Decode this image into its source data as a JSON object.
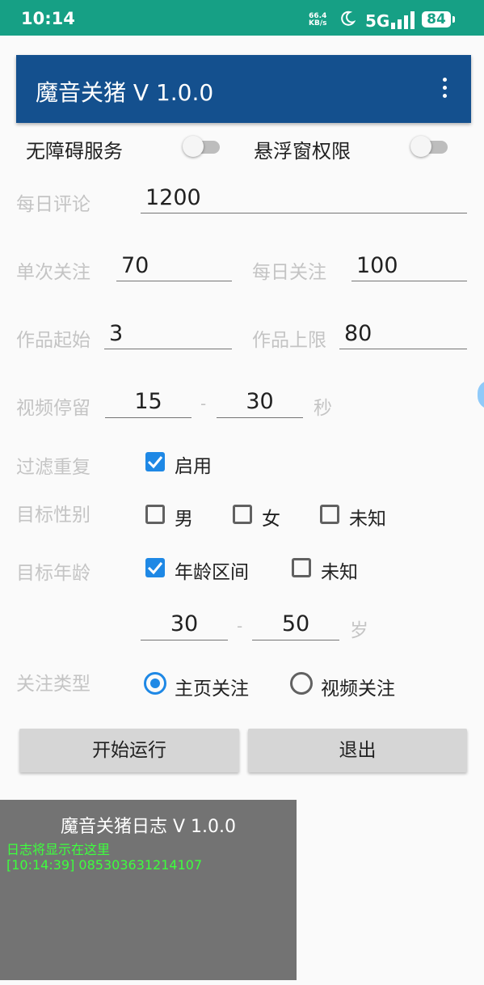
{
  "status_bar": {
    "time": "10:14",
    "net_speed": "66.4",
    "net_unit": "KB/s",
    "network": "5G",
    "battery": "84",
    "icons": [
      "moon-icon",
      "signal-icon",
      "battery-icon"
    ]
  },
  "app_bar": {
    "title": "魔音关猪 V 1.0.0",
    "menu_icon": "more-vert-icon"
  },
  "permissions": {
    "accessibility_label": "无障碍服务",
    "overlay_label": "悬浮窗权限"
  },
  "form": {
    "daily_comment": {
      "label": "每日评论",
      "value": "1200"
    },
    "single_follow": {
      "label": "单次关注",
      "value": "70"
    },
    "daily_follow": {
      "label": "每日关注",
      "value": "100"
    },
    "works_start": {
      "label": "作品起始",
      "value": "3"
    },
    "works_limit": {
      "label": "作品上限",
      "value": "80"
    },
    "video_stay": {
      "label": "视频停留",
      "min": "15",
      "sep": "-",
      "max": "30",
      "unit": "秒"
    },
    "filter_dup": {
      "label": "过滤重复",
      "option": "启用",
      "checked": true
    },
    "gender": {
      "label": "目标性别",
      "options": [
        {
          "label": "男",
          "checked": false
        },
        {
          "label": "女",
          "checked": false
        },
        {
          "label": "未知",
          "checked": false
        }
      ]
    },
    "age": {
      "label": "目标年龄",
      "options": [
        {
          "label": "年龄区间",
          "checked": true
        },
        {
          "label": "未知",
          "checked": false
        }
      ],
      "min": "30",
      "sep": "-",
      "max": "50",
      "unit": "岁"
    },
    "follow_type": {
      "label": "关注类型",
      "options": [
        {
          "label": "主页关注",
          "selected": true
        },
        {
          "label": "视频关注",
          "selected": false
        }
      ]
    }
  },
  "buttons": {
    "start": "开始运行",
    "exit": "退出"
  },
  "log": {
    "title": "魔音关猪日志 V 1.0.0",
    "lines": [
      "日志将显示在这里",
      "[10:14:39] 085303631214107"
    ]
  },
  "colors": {
    "status_bar": "#16a085",
    "app_bar": "#14508e",
    "accent": "#1e88e5",
    "log_bg": "#737373",
    "log_text": "#3dff3d"
  }
}
